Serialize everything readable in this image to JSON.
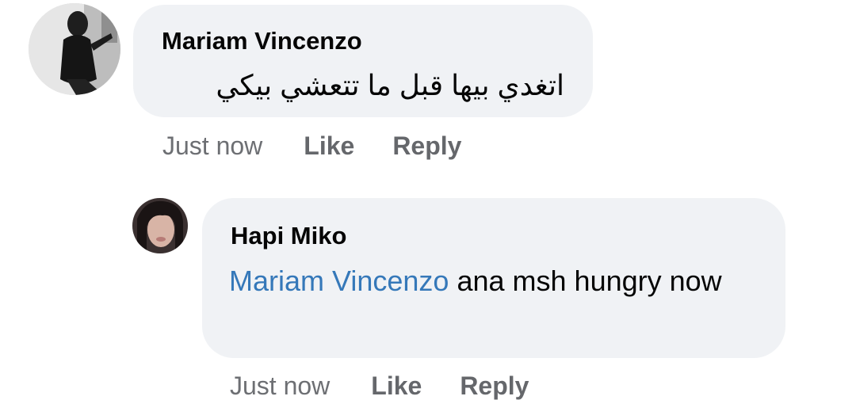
{
  "comments": [
    {
      "author": "Mariam Vincenzo",
      "text": "اتغدي  بيها قبل ما تتعشي بيكي",
      "time": "Just now",
      "like_label": "Like",
      "reply_label": "Reply",
      "avatar_icon": "profile-photo-dark-outfit"
    },
    {
      "author": "Hapi Miko",
      "mention": "Mariam Vincenzo",
      "text": "ana msh hungry now",
      "time": "Just now",
      "like_label": "Like",
      "reply_label": "Reply",
      "avatar_icon": "profile-photo-face"
    }
  ],
  "colors": {
    "bubble": "#f0f2f5",
    "mention": "#3578b9",
    "meta": "#65676b"
  }
}
